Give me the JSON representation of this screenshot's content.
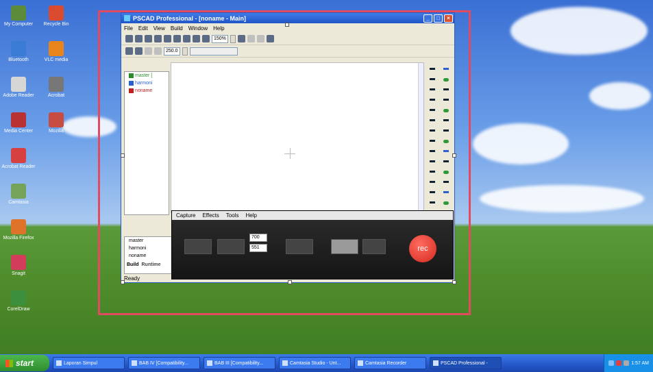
{
  "desktop": {
    "icons": [
      {
        "label": "My Computer",
        "color": "#5c8b3a"
      },
      {
        "label": "Recycle Bin",
        "color": "#d94a2f"
      },
      {
        "label": "Bluetooth",
        "color": "#3a7bd6"
      },
      {
        "label": "VLC media",
        "color": "#e8841c"
      },
      {
        "label": "Adobe Reader",
        "color": "#d6d6d6"
      },
      {
        "label": "Acrobat",
        "color": "#777"
      },
      {
        "label": "Media Center",
        "color": "#b83232"
      },
      {
        "label": "Mozilla",
        "color": "#c74d42"
      },
      {
        "label": "Acrobat Reader",
        "color": "#d64040"
      },
      {
        "label": "Camtasia",
        "color": "#76a35a"
      },
      {
        "label": "Mozilla Firefox",
        "color": "#e0732a"
      },
      {
        "label": "Snagit",
        "color": "#d43c5c"
      },
      {
        "label": "CorelDraw",
        "color": "#3c8f3c"
      }
    ]
  },
  "app": {
    "title": "PSCAD Professional - [noname - Main]",
    "menu": [
      "File",
      "Edit",
      "View",
      "Build",
      "Window",
      "Help"
    ],
    "zoom": "150%",
    "time_value": "250.0",
    "tree": [
      {
        "label": "master [",
        "color": "#2c8c2c"
      },
      {
        "label": "harmoni",
        "color": "#2a5fd0"
      },
      {
        "label": "noname",
        "color": "#c02020"
      }
    ],
    "lower_tree": [
      "master",
      "harmoni",
      "noname"
    ],
    "tab_build": "Build",
    "tab_runtime": "Runtime",
    "status": "Ready"
  },
  "recorder": {
    "menu": [
      "Capture",
      "Effects",
      "Tools",
      "Help"
    ],
    "width": "700",
    "height": "551",
    "rec_label": "rec"
  },
  "taskbar": {
    "start": "start",
    "tasks": [
      "Laporan Simpul",
      "BAB IV [Compatibility...",
      "BAB III [Compatibility...",
      "Camtasia Studio - Unt...",
      "Camtasia Recorder",
      "PSCAD Professional -"
    ],
    "clock": "1:57 AM"
  },
  "colors": {
    "capture_rect": "#e24a5f",
    "taskbar": "#2457c8",
    "start": "#2f8c2f"
  }
}
